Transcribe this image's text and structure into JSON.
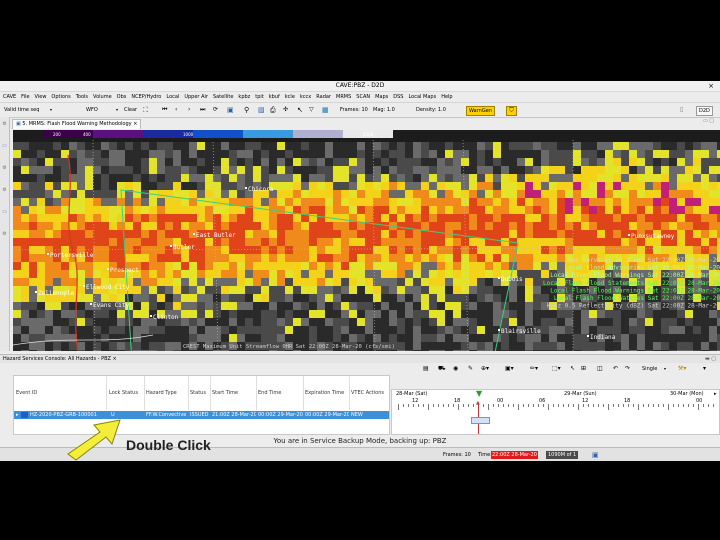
{
  "window": {
    "title": "CAVE:PBZ - D2D",
    "close": "×"
  },
  "menu": [
    "CAVE",
    "File",
    "View",
    "Options",
    "Tools",
    "Volume",
    "Obs",
    "NCEP/Hydro",
    "Local",
    "Upper Air",
    "Satellite",
    "kpbz",
    "tpit",
    "kbuf",
    "kcle",
    "kccx",
    "Radar",
    "MRMS",
    "SCAN",
    "Maps",
    "DSS",
    "Local Maps",
    "Help"
  ],
  "toolbar": {
    "valid_time": "Valid time seq",
    "wfo": "WFO",
    "clear": "Clear",
    "frames": "Frames: 10",
    "mag": "Mag: 1.0",
    "density": "Density: 1.0",
    "warngen": "WarnGen",
    "d2d": "D2D"
  },
  "editor_tab": "5. MRMS: Flash Flood Warning Methodology",
  "map": {
    "colorbar_labels": [
      "200",
      "400",
      "1000",
      "2000"
    ],
    "cities": [
      "Chicora",
      "Butler",
      "East Butler",
      "Evans City",
      "Saxonburg",
      "Sarver",
      "Indiana",
      "Blairsville",
      "Freeport",
      "Elderton",
      "Kittanning",
      "Punxsutawney",
      "Dubois",
      "Zelienople",
      "Ellwood City",
      "Mars",
      "Prospect",
      "Portersville",
      "Clinton"
    ],
    "legend": [
      {
        "text": "Svc Services  28.2  0HR Sat 22:00Z 28-Mar-20",
        "color": "#d8d8d8"
      },
      {
        "text": "Local Flood Advisories Sat 22:00Z 28-Mar-20",
        "color": "#aaffaa"
      },
      {
        "text": "Local River Flood Warnings Sat 22:00Z 28-Mar-20",
        "color": "#aaffaa"
      },
      {
        "text": "Local Flash Flood Statements Sat 22:00Z 28-Mar-20",
        "color": "#55ff55"
      },
      {
        "text": "Local Flash Flood Warnings Sat 22:00Z 28-Mar-20",
        "color": "#55ff55"
      },
      {
        "text": "Local Flash Flood Watches Sat 22:00Z 28-Mar-20",
        "color": "#55ff55"
      },
      {
        "text": "kpbz 0.5  Reflectivity (dBZ) Sat 22:00Z 28-Mar-20",
        "color": "#cfcfcf"
      }
    ],
    "bottom_caption": "CREST Maximum Unit Streamflow  0HR Sat 22:00Z 28-Mar-20 (cfs/smi)"
  },
  "console": {
    "title": "Hazard Services Console: All Hazards - PBZ",
    "setup": "Single",
    "columns": [
      "Event ID",
      "Lock Status",
      "Hazard Type",
      "Status",
      "Start Time",
      "End Time",
      "Expiration Time",
      "VTEC Actions"
    ],
    "rows": [
      {
        "event_id": "HZ-2020-PBZ-GRB-100001",
        "lock": "U",
        "type": "FF.W.Convective",
        "status": "ISSUED",
        "start": "21:00Z 28-Mar-20",
        "end": "00:00Z 29-Mar-20",
        "expiration": "00:00Z 29-Mar-20",
        "vtec": "NEW"
      }
    ],
    "timeline": {
      "days": [
        "28-Mar (Sat)",
        "29-Mar (Sun)",
        "30-Mar (Mon)"
      ],
      "hours": [
        "12",
        "18",
        "00",
        "06",
        "12",
        "18",
        "00"
      ]
    }
  },
  "status_message": "You are in Service Backup Mode, backing up: PBZ",
  "bottom": {
    "frames": "Frames: 10",
    "time_label": "Time:",
    "time": "22:00Z 28-Mar-20",
    "memory": "1090M of 1"
  },
  "annotation": {
    "text": "Double Click",
    "arrow_color": "#f2ee3a"
  }
}
